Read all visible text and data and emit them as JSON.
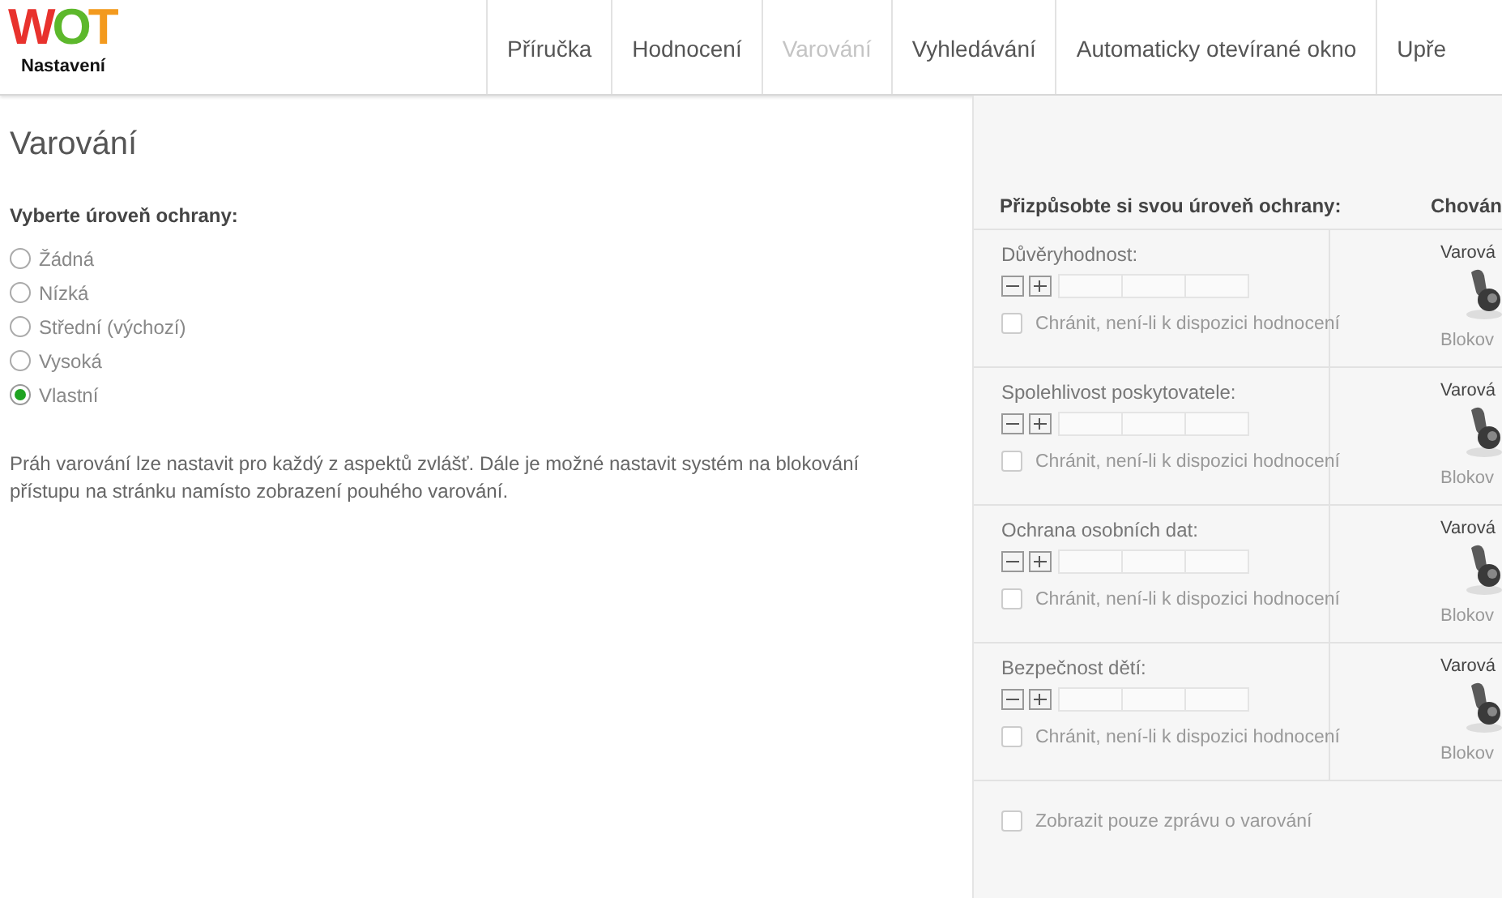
{
  "logo": {
    "letters": [
      {
        "text": "W",
        "color": "#e8322d"
      },
      {
        "text": "O",
        "color": "#5db82c"
      },
      {
        "text": "T",
        "color": "#f39a1e"
      }
    ],
    "caption": "Nastavení"
  },
  "tabs": [
    {
      "label": "Příručka",
      "selected": false
    },
    {
      "label": "Hodnocení",
      "selected": false
    },
    {
      "label": "Varování",
      "selected": true
    },
    {
      "label": "Vyhledávání",
      "selected": false
    },
    {
      "label": "Automaticky otevírané okno",
      "selected": false
    },
    {
      "label": "Upře",
      "selected": false
    }
  ],
  "page_title": "Varování",
  "levels": {
    "heading": "Vyberte úroveň ochrany:",
    "options": [
      {
        "label": "Žádná",
        "selected": false
      },
      {
        "label": "Nízká",
        "selected": false
      },
      {
        "label": "Střední (výchozí)",
        "selected": false
      },
      {
        "label": "Vysoká",
        "selected": false
      },
      {
        "label": "Vlastní",
        "selected": true
      }
    ]
  },
  "description": "Práh varování lze nastavit pro každý z aspektů zvlášť. Dále je možné nastavit systém na blokování přístupu na stránku namísto zobrazení pouhého varování.",
  "custom": {
    "heading": "Přizpůsobte si svou úroveň ochrany:",
    "behavior_heading": "Chován",
    "rows": [
      {
        "name": "Důvěryhodnost:",
        "checkbox": "Chránit, není-li k dispozici hodnocení",
        "checked": false,
        "top_label": "Varová",
        "bottom_label": "Blokov"
      },
      {
        "name": "Spolehlivost poskytovatele:",
        "checkbox": "Chránit, není-li k dispozici hodnocení",
        "checked": false,
        "top_label": "Varová",
        "bottom_label": "Blokov"
      },
      {
        "name": "Ochrana osobních dat:",
        "checkbox": "Chránit, není-li k dispozici hodnocení",
        "checked": false,
        "top_label": "Varová",
        "bottom_label": "Blokov"
      },
      {
        "name": "Bezpečnost dětí:",
        "checkbox": "Chránit, není-li k dispozici hodnocení",
        "checked": false,
        "top_label": "Varová",
        "bottom_label": "Blokov"
      }
    ],
    "warning_only": {
      "label": "Zobrazit pouze zprávu o varování",
      "checked": false
    }
  }
}
